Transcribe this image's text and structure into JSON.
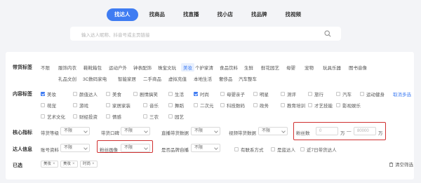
{
  "top_tabs": [
    "找达人",
    "找商品",
    "找直播",
    "找小店",
    "找品牌",
    "找视频"
  ],
  "search": {
    "placeholder": "输入达人昵称、抖音号或主页链接"
  },
  "goods_tags": {
    "label": "带货标签",
    "row1": [
      "不限",
      "服饰内衣",
      "鞋靴箱包",
      "运动户外",
      "钟表配饰",
      "珠宝文玩",
      "美妆",
      "个护家清",
      "食品饮料",
      "生鲜",
      "鲜花园艺",
      "母婴",
      "宠物",
      "玩具乐器",
      "图书音像"
    ],
    "row2": [
      "礼品文创",
      "3C数码家电",
      "智能家居",
      "二手商品",
      "虚拟充值",
      "本地生活",
      "奢侈品",
      "汽车整车"
    ],
    "active": "美妆"
  },
  "content_tags": {
    "label": "内容标签",
    "items": [
      [
        "美妆",
        "颜值达人",
        "美食",
        "剧情搞笑",
        "生活",
        "时尚",
        "母婴亲子",
        "明星",
        "测评",
        "旅行",
        "汽车",
        "运动健身"
      ],
      [
        "萌宠",
        "游戏",
        "家居家装",
        "音乐",
        "舞蹈",
        "二次元",
        "科技数码",
        "政务",
        "教育培训",
        "才艺技能",
        "影视娱乐"
      ],
      [
        "艺术文化",
        "财经投资",
        "情感",
        "三农",
        "园艺"
      ]
    ],
    "checked": [
      "美妆",
      "时尚"
    ],
    "cancel_label": "取消多选"
  },
  "core_metrics": {
    "label": "核心指标",
    "fields": [
      {
        "label": "带货等级",
        "value": "不限"
      },
      {
        "label": "带货口碑",
        "value": "不限"
      },
      {
        "label": "直播带货数据",
        "value": "不限"
      },
      {
        "label": "视频带货数据",
        "value": "不限"
      }
    ],
    "fans": {
      "label": "粉丝数",
      "min": "0",
      "max": "80000",
      "unit": "万",
      "sep": "—"
    }
  },
  "talent_info": {
    "label": "达人信息",
    "fields": [
      {
        "label": "账号资料",
        "value": "不限"
      },
      {
        "label": "粉丝画像",
        "value": "不限"
      },
      {
        "label": "是否品牌自播",
        "value": "不限"
      }
    ],
    "checkboxes": [
      "有联系方式",
      "是蓝达人",
      "近7日带货达人"
    ]
  },
  "selected": {
    "label": "已选",
    "tags": [
      "美妆",
      "美妆",
      "时尚"
    ],
    "clear_label": "清空筛选"
  },
  "colors": {
    "accent": "#3f7cf2",
    "highlight": "#d03030"
  }
}
